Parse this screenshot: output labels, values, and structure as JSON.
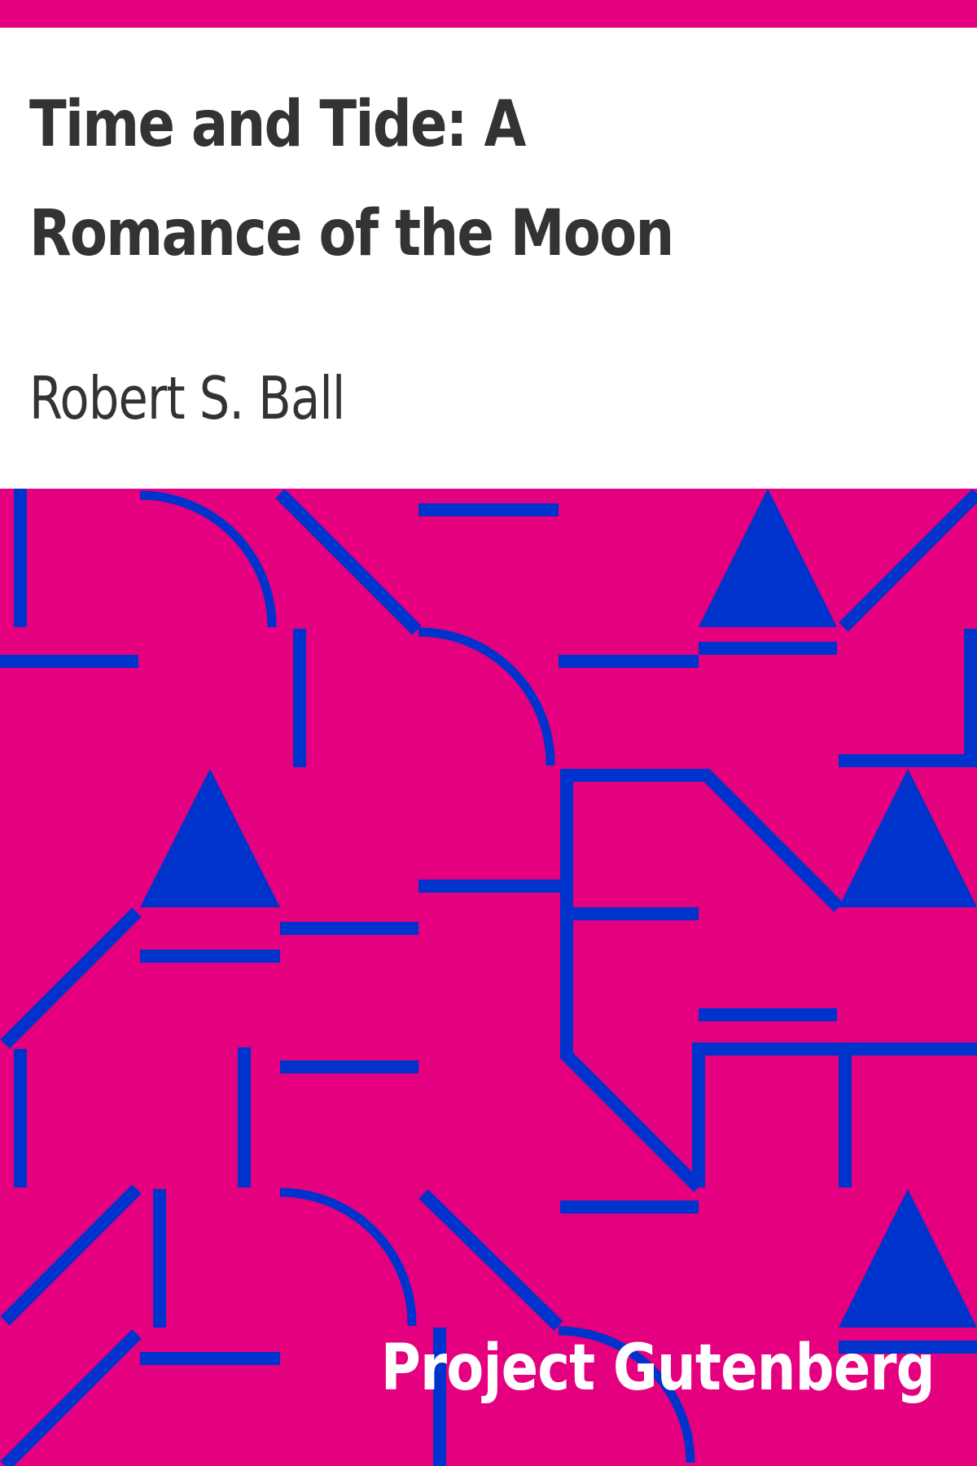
{
  "book": {
    "title": "Time and Tide: A Romance of the Moon",
    "author": "Robert S. Ball",
    "publisher": "Project Gutenberg"
  },
  "colors": {
    "background": "#e4007f",
    "pattern": "#0033cc",
    "title_text": "#333333",
    "publisher_text": "#ffffff",
    "title_background": "#ffffff"
  }
}
